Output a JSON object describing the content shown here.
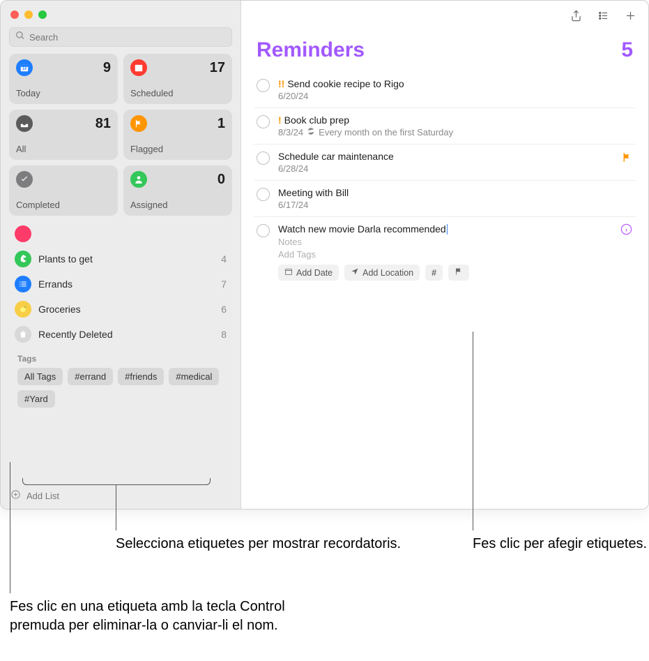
{
  "sidebar": {
    "search_placeholder": "Search",
    "smart": [
      {
        "label": "Today",
        "count": 9,
        "color": "#1f7eff"
      },
      {
        "label": "Scheduled",
        "count": 17,
        "color": "#ff3b30"
      },
      {
        "label": "All",
        "count": 81,
        "color": "#5b5b5c"
      },
      {
        "label": "Flagged",
        "count": 1,
        "color": "#ff9500"
      },
      {
        "label": "Completed",
        "count": "",
        "color": "#7d7d80"
      },
      {
        "label": "Assigned",
        "count": 0,
        "color": "#34c759"
      }
    ],
    "lists": [
      {
        "name": "Plants to get",
        "count": 4,
        "color": "#34c759"
      },
      {
        "name": "Errands",
        "count": 7,
        "color": "#1f7eff"
      },
      {
        "name": "Groceries",
        "count": 6,
        "color": "#f7ce46"
      },
      {
        "name": "Recently Deleted",
        "count": 8,
        "color": "#8a8a8a"
      }
    ],
    "tags_header": "Tags",
    "tags": [
      "All Tags",
      "#errand",
      "#friends",
      "#medical",
      "#Yard"
    ],
    "add_list": "Add List"
  },
  "main": {
    "title": "Reminders",
    "title_color": "#a259ff",
    "count": 5,
    "reminders": [
      {
        "priority": "!!",
        "title": "Send cookie recipe to Rigo",
        "date": "6/20/24"
      },
      {
        "priority": "!",
        "title": "Book club prep",
        "date": "8/3/24",
        "repeat": "Every month on the first Saturday"
      },
      {
        "title": "Schedule car maintenance",
        "date": "6/28/24",
        "flagged": true
      },
      {
        "title": "Meeting with Bill",
        "date": "6/17/24"
      },
      {
        "title": "Watch new movie Darla recommended",
        "editing": true,
        "notes_ph": "Notes",
        "tags_ph": "Add Tags"
      }
    ],
    "actions": {
      "add_date": "Add Date",
      "add_location": "Add Location"
    }
  },
  "callouts": {
    "c1": "Selecciona etiquetes per mostrar recordatoris.",
    "c2": "Fes clic per afegir etiquetes.",
    "c3": "Fes clic en una etiqueta amb la tecla Control premuda per eliminar-la o canviar-li el nom."
  }
}
